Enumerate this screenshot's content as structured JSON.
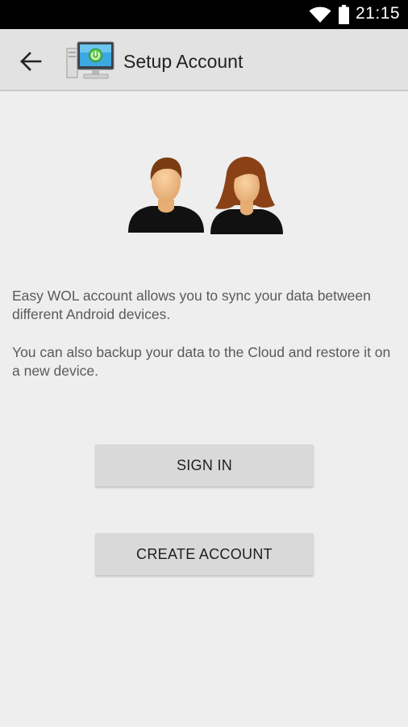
{
  "status_bar": {
    "time": "21:15",
    "icons": [
      "wifi-icon",
      "battery-icon"
    ]
  },
  "toolbar": {
    "title": "Setup Account",
    "back_icon": "arrow-back-icon",
    "app_icon": "computer-power-icon"
  },
  "illustration": {
    "icon": "users-icon"
  },
  "description": {
    "paragraph1": "Easy WOL account allows you to sync your data between different Android devices.",
    "paragraph2": "You can also backup your data to the Cloud and restore it on a new device."
  },
  "buttons": {
    "sign_in": "SIGN IN",
    "create_account": "CREATE ACCOUNT"
  },
  "colors": {
    "background": "#eeeeee",
    "toolbar": "#e2e2e2",
    "button": "#d9d9d9",
    "status_bar": "#000000"
  }
}
